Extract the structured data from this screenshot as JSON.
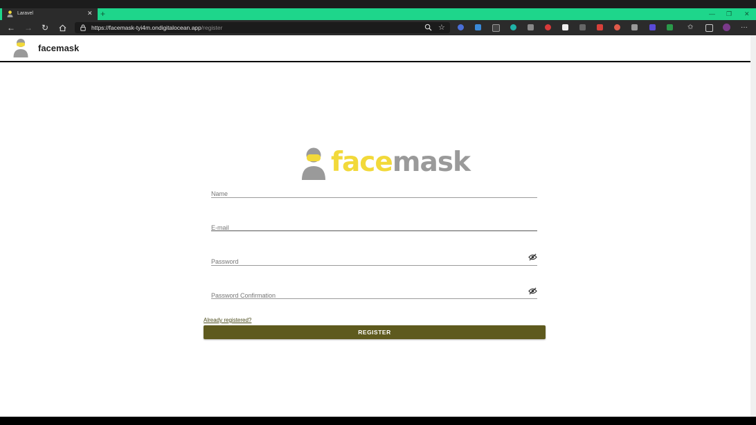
{
  "browser": {
    "tab_title": "Laravel",
    "url_host": "https://facemask-tyi4m.ondigitalocean.app",
    "url_path": "/register",
    "accent_color": "#1ed68b"
  },
  "header": {
    "title": "facemask"
  },
  "logo": {
    "text_face": "face",
    "text_mask": "mask",
    "face_color": "#f2d93a",
    "mask_color": "#9a9a9a"
  },
  "form": {
    "name_placeholder": "Name",
    "email_placeholder": "E-mail",
    "password_placeholder": "Password",
    "password_confirmation_placeholder": "Password Confirmation",
    "login_link": "Already registered?",
    "register_button": "REGISTER",
    "button_color": "#5e5a1e"
  },
  "icons": {
    "tab": "user-mask-icon",
    "close": "close-icon",
    "password_toggle": "eye-off-icon"
  }
}
